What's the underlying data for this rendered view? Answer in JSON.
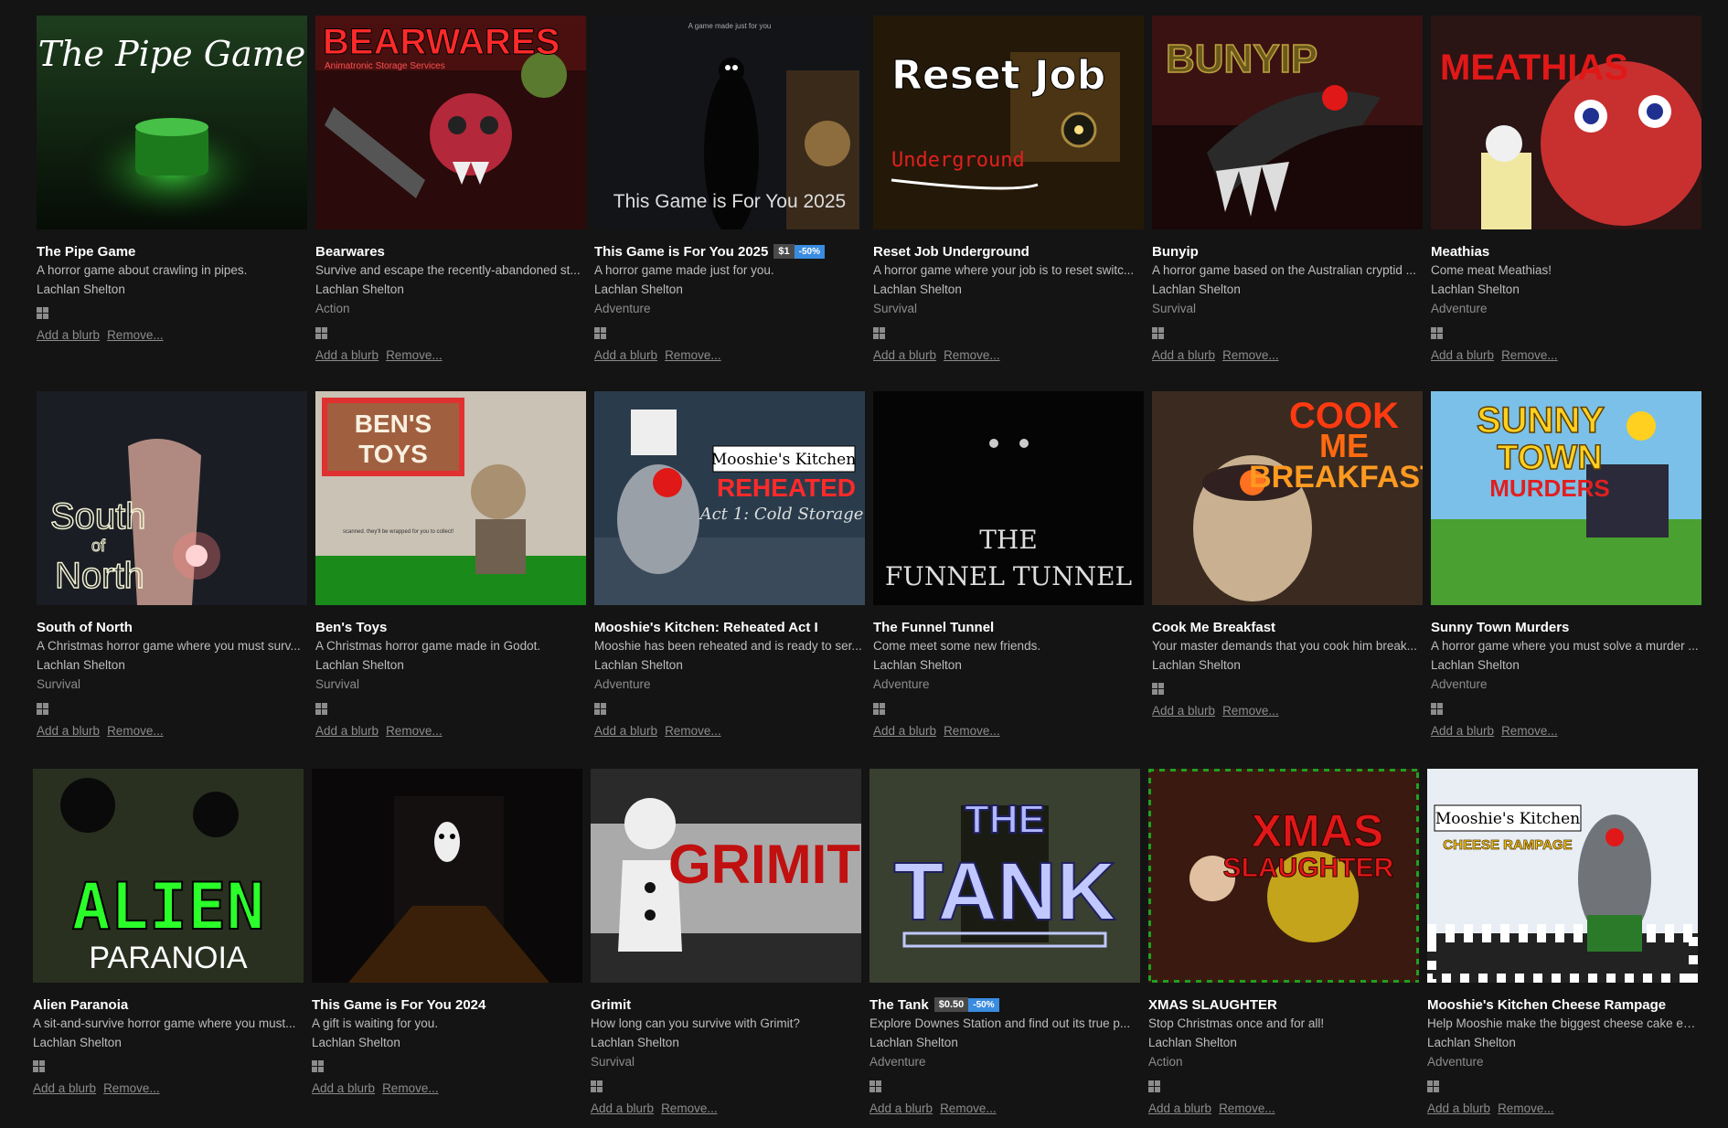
{
  "games": [
    {
      "title": "The Pipe Game",
      "desc": "A horror game about crawling in pipes.",
      "author": "Lachlan Shelton",
      "genre": "",
      "cover_text": "The Pipe Game",
      "cover_style": "pipe"
    },
    {
      "title": "Bearwares",
      "desc": "Survive and escape the recently-abandoned st...",
      "author": "Lachlan Shelton",
      "genre": "Action",
      "cover_text": "BEARWARES",
      "cover_sub": "Animatronic Storage Services",
      "cover_style": "bearwares"
    },
    {
      "title": "This Game is For You 2025",
      "price": "$1",
      "discount": "-50%",
      "desc": "A horror game made just for you.",
      "author": "Lachlan Shelton",
      "genre": "Adventure",
      "cover_text": "This Game is For You 2025",
      "cover_sub": "A game made just for you",
      "cover_style": "foryou"
    },
    {
      "title": "Reset Job Underground",
      "desc": "A horror game where your job is to reset switc...",
      "author": "Lachlan Shelton",
      "genre": "Survival",
      "cover_text": "Reset Job",
      "cover_sub": "Underground",
      "cover_style": "reset"
    },
    {
      "title": "Bunyip",
      "desc": "A horror game based on the Australian cryptid ...",
      "author": "Lachlan Shelton",
      "genre": "Survival",
      "cover_text": "BUNYIP",
      "cover_style": "bunyip"
    },
    {
      "title": "Meathias",
      "desc": "Come meat Meathias!",
      "author": "Lachlan Shelton",
      "genre": "Adventure",
      "cover_text": "MEATHIAS",
      "cover_style": "meathias"
    },
    {
      "title": "South of North",
      "desc": "A Christmas horror game where you must surv...",
      "author": "Lachlan Shelton",
      "genre": "Survival",
      "cover_text": "South",
      "cover_sub": "of",
      "cover_sub2": "North",
      "cover_style": "south"
    },
    {
      "title": "Ben's Toys",
      "desc": "A Christmas horror game made in Godot.",
      "author": "Lachlan Shelton",
      "genre": "Survival",
      "cover_text": "BEN'S",
      "cover_sub": "TOYS",
      "cover_sub2": "scanned. they'll be wrapped for you to collect!",
      "cover_style": "bens"
    },
    {
      "title": "Mooshie's Kitchen: Reheated Act I",
      "desc": "Mooshie has been reheated and is ready to ser...",
      "author": "Lachlan Shelton",
      "genre": "Adventure",
      "cover_text": "Mooshie's Kitchen",
      "cover_sub": "REHEATED",
      "cover_sub2": "Act 1: Cold Storage",
      "cover_style": "mooshie"
    },
    {
      "title": "The Funnel Tunnel",
      "desc": "Come meet some new friends.",
      "author": "Lachlan Shelton",
      "genre": "Adventure",
      "cover_text": "THE",
      "cover_sub": "FUNNEL TUNNEL",
      "cover_style": "funnel"
    },
    {
      "title": "Cook Me Breakfast",
      "desc": "Your master demands that you cook him break...",
      "author": "Lachlan Shelton",
      "genre": "",
      "cover_text": "COOK",
      "cover_sub": "ME",
      "cover_sub2": "BREAKFAST",
      "cover_style": "cook"
    },
    {
      "title": "Sunny Town Murders",
      "desc": "A horror game where you must solve a murder ...",
      "author": "Lachlan Shelton",
      "genre": "Adventure",
      "cover_text": "SUNNY",
      "cover_sub": "TOWN",
      "cover_sub2": "MURDERS",
      "cover_style": "sunny"
    },
    {
      "title": "Alien Paranoia",
      "desc": "A sit-and-survive horror game where you must...",
      "author": "Lachlan Shelton",
      "genre": "",
      "cover_text": "ALIEN",
      "cover_sub": "PARANOIA",
      "cover_style": "alien"
    },
    {
      "title": "This Game is For You 2024",
      "desc": "A gift is waiting for you.",
      "author": "Lachlan Shelton",
      "genre": "",
      "cover_text": "",
      "cover_style": "foryou24"
    },
    {
      "title": "Grimit",
      "desc": "How long can you survive with Grimit?",
      "author": "Lachlan Shelton",
      "genre": "Survival",
      "cover_text": "GRIMIT",
      "cover_style": "grimit"
    },
    {
      "title": "The Tank",
      "price": "$0.50",
      "discount": "-50%",
      "desc": "Explore Downes Station and find out its true p...",
      "author": "Lachlan Shelton",
      "genre": "Adventure",
      "cover_text": "THE",
      "cover_sub": "TANK",
      "cover_style": "tank"
    },
    {
      "title": "XMAS SLAUGHTER",
      "desc": "Stop Christmas once and for all!",
      "author": "Lachlan Shelton",
      "genre": "Action",
      "cover_text": "XMAS",
      "cover_sub": "SLAUGHTER",
      "cover_style": "xmas"
    },
    {
      "title": "Mooshie's Kitchen Cheese Rampage",
      "desc": "Help Mooshie make the biggest cheese cake ev...",
      "author": "Lachlan Shelton",
      "genre": "Adventure",
      "cover_text": "Mooshie's Kitchen",
      "cover_sub": "CHEESE RAMPAGE",
      "cover_style": "cheese"
    }
  ],
  "labels": {
    "add_blurb": "Add a blurb",
    "remove": "Remove..."
  },
  "icons": {
    "platform": "windows-icon"
  },
  "colors": {
    "background": "#141414",
    "discount": "#3a8ce0",
    "price": "#4a4a4a"
  }
}
